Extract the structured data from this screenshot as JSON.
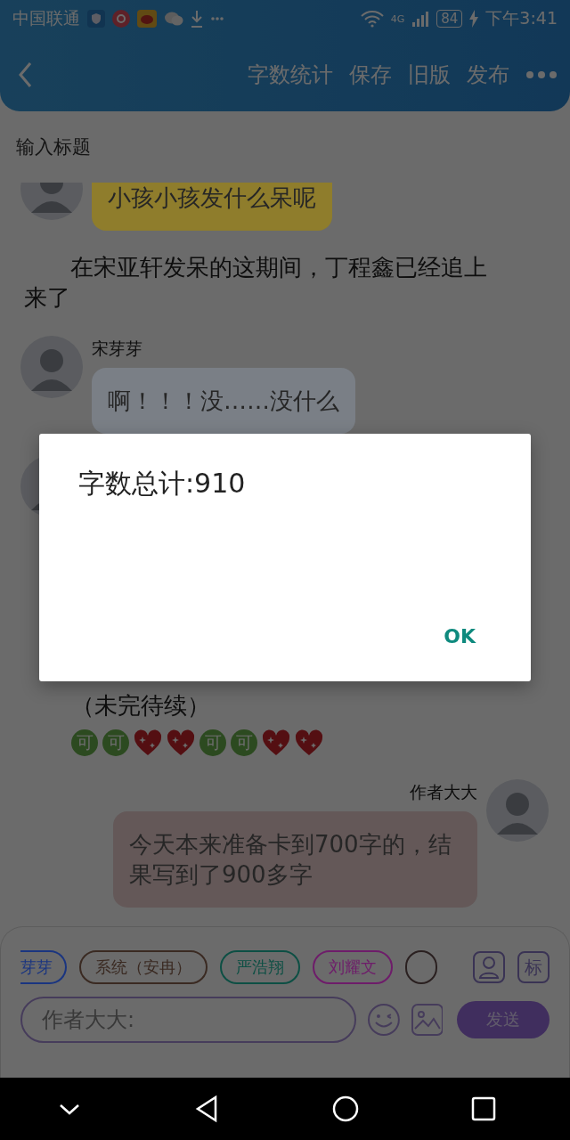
{
  "status_bar": {
    "carrier": "中国联通",
    "network": "4G",
    "battery": "84",
    "time": "下午3:41"
  },
  "header": {
    "actions": [
      "字数统计",
      "保存",
      "旧版",
      "发布"
    ]
  },
  "title_field": {
    "placeholder": "输入标题"
  },
  "messages": [
    {
      "kind": "left_bubble",
      "color": "#8f7d2c",
      "text": "小孩小孩发什么呆呢"
    },
    {
      "kind": "narration",
      "text": "在宋亚轩发呆的这期间，丁程鑫已经追上来了"
    },
    {
      "kind": "left_bubble",
      "name": "宋芽芽",
      "color": "#7a7f86",
      "text": "啊！！！没……没什么"
    },
    {
      "kind": "hidden_avatar"
    },
    {
      "kind": "note",
      "text": "（未完待续）"
    },
    {
      "kind": "emoji_row",
      "items": [
        {
          "kind": "badge",
          "text": "可"
        },
        {
          "kind": "badge",
          "text": "可"
        },
        {
          "kind": "heart"
        },
        {
          "kind": "heart"
        },
        {
          "kind": "badge",
          "text": "可"
        },
        {
          "kind": "badge",
          "text": "可"
        },
        {
          "kind": "heart"
        },
        {
          "kind": "heart"
        }
      ]
    },
    {
      "kind": "right_bubble",
      "name": "作者大大",
      "color": "#645858",
      "text": "今天本来准备卡到700字的，结果写到了900多字"
    }
  ],
  "composer": {
    "roles": [
      {
        "label": "芽芽",
        "color": "#1a3580",
        "cut": true
      },
      {
        "label": "系统（安冉）",
        "color": "#3a2a22",
        "cut": false
      },
      {
        "label": "严浩翔",
        "color": "#0d4f44",
        "cut": false
      },
      {
        "label": "刘耀文",
        "color": "#6e1c6a",
        "cut": false
      },
      {
        "color": "#2a2020",
        "cut": false
      }
    ],
    "tag_button": "标",
    "input": {
      "placeholder": "作者大大:"
    },
    "send": "发送"
  },
  "dialog": {
    "message": "字数总计:910",
    "button": "OK"
  }
}
